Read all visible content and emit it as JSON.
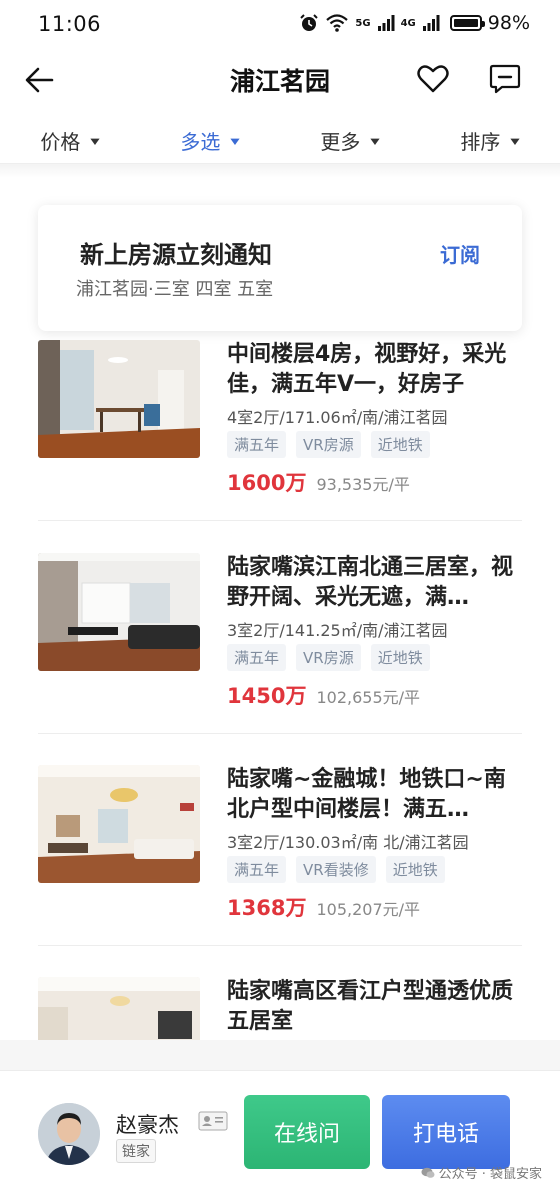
{
  "status_bar": {
    "time": "11:06",
    "network_1": "5G",
    "network_2": "4G",
    "battery": "98%"
  },
  "nav": {
    "title": "浦江茗园"
  },
  "filters": [
    {
      "label": "价格",
      "active": false
    },
    {
      "label": "多选",
      "active": true
    },
    {
      "label": "更多",
      "active": false
    },
    {
      "label": "排序",
      "active": false
    }
  ],
  "subscribe": {
    "title": "新上房源立刻通知",
    "subtitle": "浦江茗园·三室 四室 五室",
    "button": "订阅"
  },
  "listings": [
    {
      "title": "中间楼层4房，视野好，采光佳，满五年V一，好房子",
      "meta": "4室2厅/171.06㎡/南/浦江茗园",
      "tags": [
        "满五年",
        "VR房源",
        "近地铁"
      ],
      "price": "1600万",
      "unit_price": "93,535元/平"
    },
    {
      "title": "陆家嘴滨江南北通三居室，视野开阔、采光无遮，满…",
      "meta": "3室2厅/141.25㎡/南/浦江茗园",
      "tags": [
        "满五年",
        "VR房源",
        "近地铁"
      ],
      "price": "1450万",
      "unit_price": "102,655元/平"
    },
    {
      "title": "陆家嘴~金融城！地铁口~南北户型中间楼层！满五…",
      "meta": "3室2厅/130.03㎡/南 北/浦江茗园",
      "tags": [
        "满五年",
        "VR看装修",
        "近地铁"
      ],
      "price": "1368万",
      "unit_price": "105,207元/平"
    },
    {
      "title": "陆家嘴高区看江户型通透优质五居室",
      "meta": "",
      "tags": [],
      "price": "",
      "unit_price": ""
    }
  ],
  "agent": {
    "name": "赵豪杰",
    "company": "链家",
    "online_button": "在线问",
    "call_button": "打电话"
  },
  "watermark": "公众号 · 袋鼠安家",
  "colors": {
    "accent_blue": "#3b6bd4",
    "price_red": "#e0353c",
    "green_button": "#2cb574",
    "blue_button": "#3d6de0"
  }
}
